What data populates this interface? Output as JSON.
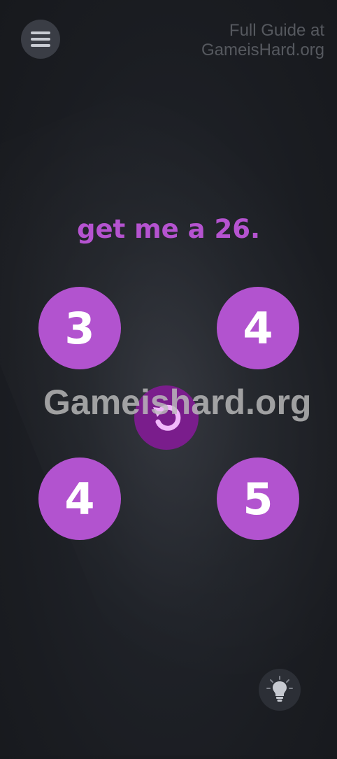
{
  "header": {
    "guide_text_line1": "Full Guide at",
    "guide_text_line2": "GameisHard.org"
  },
  "puzzle": {
    "prompt": "get me a 26.",
    "numbers": [
      "3",
      "4",
      "4",
      "5"
    ]
  },
  "watermark": "Gameishard.org",
  "icons": {
    "menu": "menu-icon",
    "undo": "undo-icon",
    "hint": "lightbulb-icon"
  },
  "colors": {
    "accent": "#b253cf",
    "accent_dark": "#7a1d8c",
    "background": "#1c1e23",
    "text_on_accent": "#ffffff"
  }
}
